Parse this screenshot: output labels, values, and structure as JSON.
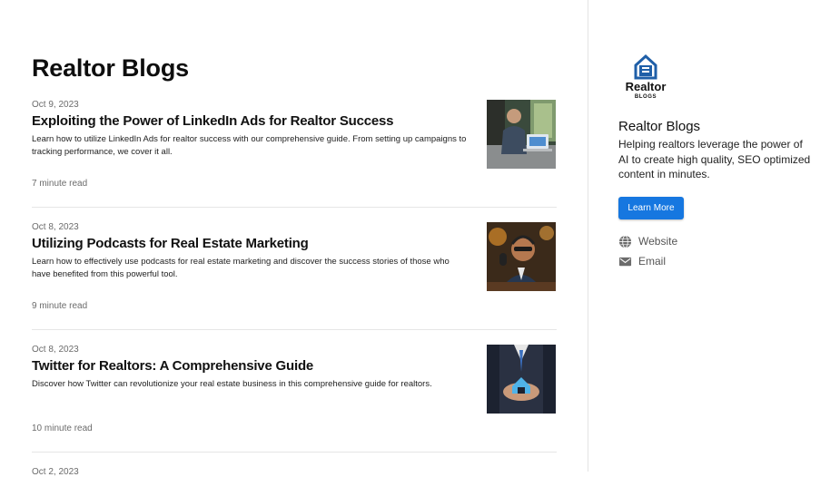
{
  "blog": {
    "title": "Realtor Blogs"
  },
  "articles": [
    {
      "date": "Oct 9, 2023",
      "title": "Exploiting the Power of LinkedIn Ads for Realtor Success",
      "description": "Learn how to utilize LinkedIn Ads for realtor success with our comprehensive guide. From setting up campaigns to tracking performance, we cover it all.",
      "read_time": "7 minute read",
      "image": "man-at-laptop-photo"
    },
    {
      "date": "Oct 8, 2023",
      "title": "Utilizing Podcasts for Real Estate Marketing",
      "description": "Learn how to effectively use podcasts for real estate marketing and discover the success stories of those who have benefited from this powerful tool.",
      "read_time": "9 minute read",
      "image": "podcast-host-photo"
    },
    {
      "date": "Oct 8, 2023",
      "title": "Twitter for Realtors: A Comprehensive Guide",
      "description": "Discover how Twitter can revolutionize your real estate business in this comprehensive guide for realtors.",
      "read_time": "10 minute read",
      "image": "realtor-holding-house-photo"
    },
    {
      "date": "Oct 2, 2023"
    }
  ],
  "sidebar": {
    "logo_text": "Realtor",
    "logo_subtext": "BLOGS",
    "title": "Realtor Blogs",
    "description": "Helping realtors leverage the power of AI to create high quality, SEO optimized content in minutes.",
    "button_label": "Learn More",
    "links": [
      {
        "label": "Website",
        "icon": "globe-icon"
      },
      {
        "label": "Email",
        "icon": "mail-icon"
      }
    ]
  },
  "colors": {
    "accent": "#1677e0",
    "logo_blue": "#1f5fa8",
    "text": "#111111",
    "muted": "#6b6b6b"
  }
}
